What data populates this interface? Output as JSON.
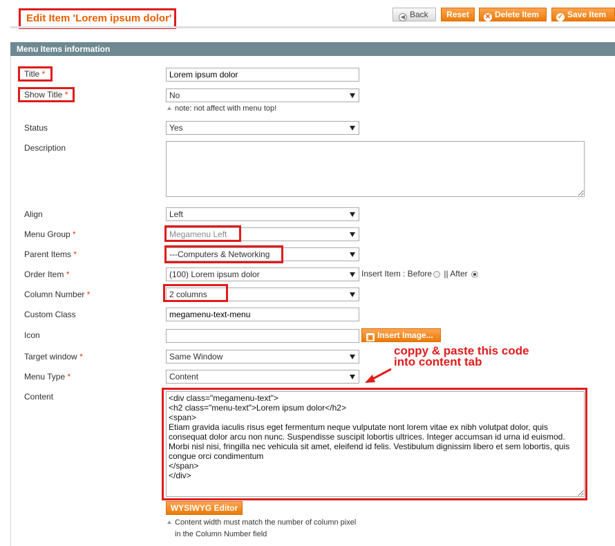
{
  "header": {
    "title": "Edit Item 'Lorem ipsum dolor'",
    "back_label": "Back",
    "reset_label": "Reset",
    "delete_label": "Delete Item",
    "save_label": "Save Item"
  },
  "section": {
    "title": "Menu Items information"
  },
  "form": {
    "title_label": "Title",
    "title_value": "Lorem ipsum dolor",
    "show_title_label": "Show Title",
    "show_title_value": "No",
    "show_title_note": "note: not affect with menu top!",
    "status_label": "Status",
    "status_value": "Yes",
    "description_label": "Description",
    "description_value": "",
    "align_label": "Align",
    "align_value": "Left",
    "menu_group_label": "Menu Group",
    "menu_group_value": "Megamenu Left",
    "parent_items_label": "Parent Items",
    "parent_items_value": "---Computers & Networking",
    "order_item_label": "Order Item",
    "order_item_value": "(100) Lorem ipsum dolor",
    "insert_item_label": "Insert Item : Before",
    "insert_after_label": "|| After",
    "column_number_label": "Column Number",
    "column_number_value": "2 columns",
    "custom_class_label": "Custom Class",
    "custom_class_value": "megamenu-text-menu",
    "icon_label": "Icon",
    "icon_value": "",
    "insert_image_label": "Insert Image...",
    "target_window_label": "Target window",
    "target_window_value": "Same Window",
    "menu_type_label": "Menu Type",
    "menu_type_value": "Content",
    "content_label": "Content",
    "content_value": "<div class=\"megamenu-text\">\n<h2 class=\"menu-text\">Lorem ipsum dolor</h2>\n<span>\nEtiam gravida iaculis risus eget fermentum neque vulputate nont lorem vitae ex nibh volutpat dolor, quis consequat dolor arcu non nunc. Suspendisse suscipit lobortis ultrices. Integer accumsan id urna id euismod. Morbi nisl nisi, fringilla nec vehicula sit amet, eleifend id felis. Vestibulum dignissim libero et sem lobortis, quis congue orci condimentum\n</span>\n</div>",
    "wysiwyg_label": "WYSIWYG Editor",
    "content_note_line1": "Content width must match the number of column pixel",
    "content_note_line2": "in the Column Number field",
    "required_mark": "*"
  },
  "annotation": {
    "line1": "coppy & paste this code",
    "line2": "into content tab"
  },
  "colors": {
    "accent_orange": "#eb5e00",
    "highlight_red": "#e01b1b",
    "section_header": "#6f8992"
  }
}
